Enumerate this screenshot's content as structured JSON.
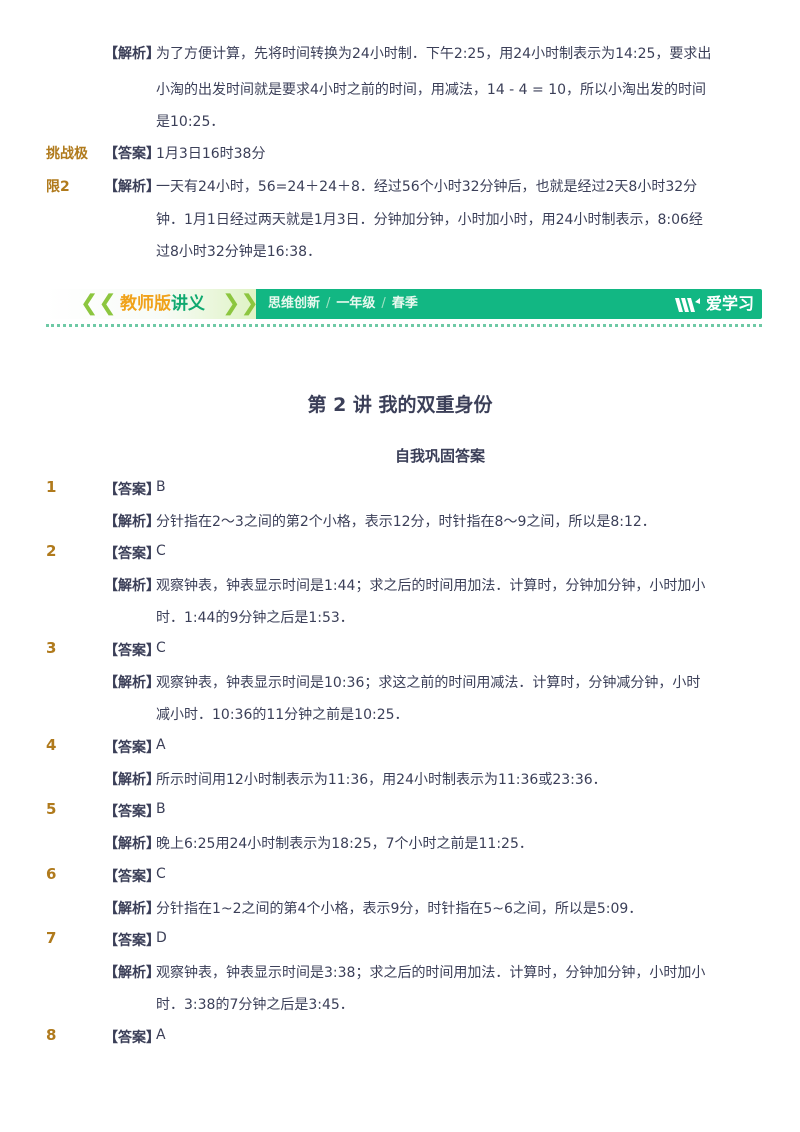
{
  "top_block": {
    "jx_tag": "【解析】",
    "jx_lines": [
      "为了方便计算，先将时间转换为24小时制．下午2:25，用24小时制表示为14:25，要求出",
      "小淘的出发时间就是要求4小时之前的时间，用减法，14 - 4 = 10，所以小淘出发的时间",
      "是10:25．"
    ]
  },
  "challenge": {
    "label_line1": "挑战极",
    "label_line2": "限2",
    "da_tag": "【答案】",
    "answer": "1月3日16时38分",
    "jx_tag": "【解析】",
    "jx_lines": [
      "一天有24小时，56=24＋24＋8．经过56个小时32分钟后，也就是经过2天8小时32分",
      "钟．1月1日经过两天就是1月3日．分钟加分钟，小时加小时，用24小时制表示，8:06经",
      "过8小时32分钟是16:38．"
    ]
  },
  "banner": {
    "title_part1": "教师版",
    "title_part2": "讲义",
    "sub1": "思维创新",
    "sub2": "一年级",
    "sub3": "春季",
    "sep": "/",
    "logo": "爱学习"
  },
  "lecture_title": "第 2 讲  我的双重身份",
  "section_title": "自我巩固答案",
  "items": [
    {
      "num": "1",
      "da_tag": "【答案】",
      "answer": "B",
      "jx_tag": "【解析】",
      "jx_lines": [
        "分针指在2～3之间的第2个小格，表示12分，时针指在8～9之间，所以是8:12．"
      ]
    },
    {
      "num": "2",
      "da_tag": "【答案】",
      "answer": "C",
      "jx_tag": "【解析】",
      "jx_lines": [
        "观察钟表，钟表显示时间是1:44；求之后的时间用加法．计算时，分钟加分钟，小时加小",
        "时．1:44的9分钟之后是1:53．"
      ]
    },
    {
      "num": "3",
      "da_tag": "【答案】",
      "answer": "C",
      "jx_tag": "【解析】",
      "jx_lines": [
        "观察钟表，钟表显示时间是10:36；求这之前的时间用减法．计算时，分钟减分钟，小时",
        "减小时．10:36的11分钟之前是10:25．"
      ]
    },
    {
      "num": "4",
      "da_tag": "【答案】",
      "answer": "A",
      "jx_tag": "【解析】",
      "jx_lines": [
        "所示时间用12小时制表示为11:36，用24小时制表示为11:36或23:36．"
      ]
    },
    {
      "num": "5",
      "da_tag": "【答案】",
      "answer": "B",
      "jx_tag": "【解析】",
      "jx_lines": [
        "晚上6:25用24小时制表示为18:25，7个小时之前是11:25．"
      ]
    },
    {
      "num": "6",
      "da_tag": "【答案】",
      "answer": "C",
      "jx_tag": "【解析】",
      "jx_lines": [
        "分针指在1~2之间的第4个小格，表示9分，时针指在5~6之间，所以是5:09．"
      ]
    },
    {
      "num": "7",
      "da_tag": "【答案】",
      "answer": "D",
      "jx_tag": "【解析】",
      "jx_lines": [
        "观察钟表，钟表显示时间是3:38；求之后的时间用加法．计算时，分钟加分钟，小时加小",
        "时．3:38的7分钟之后是3:45．"
      ]
    },
    {
      "num": "8",
      "da_tag": "【答案】",
      "answer": "A"
    }
  ]
}
